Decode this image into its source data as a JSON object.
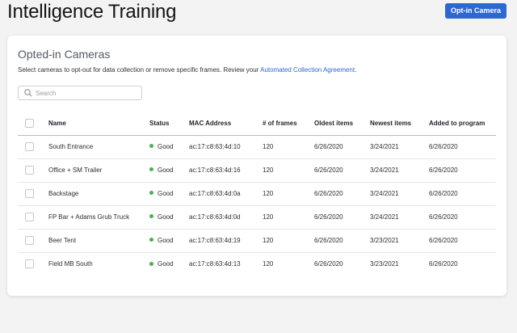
{
  "header": {
    "title": "Intelligence Training",
    "opt_in_label": "Opt-in Camera"
  },
  "card": {
    "title": "Opted-in Cameras",
    "description": "Select cameras to opt-out for data collection or remove specific frames. Review your ",
    "link_text": "Automated Collection Agreement",
    "description_end": "."
  },
  "search": {
    "placeholder": "Search"
  },
  "colors": {
    "accent": "#2d67d4",
    "status_good": "#4caf50"
  },
  "table": {
    "columns": [
      "Name",
      "Status",
      "MAC Address",
      "# of frames",
      "Oldest items",
      "Newest items",
      "Added to program"
    ],
    "rows": [
      {
        "name": "South Entrance",
        "status": "Good",
        "mac": "ac:17:c8:63:4d:10",
        "frames": "120",
        "oldest": "6/26/2020",
        "newest": "3/24/2021",
        "added": "6/26/2020"
      },
      {
        "name": "Office + SM Trailer",
        "status": "Good",
        "mac": "ac:17:c8:63:4d:16",
        "frames": "120",
        "oldest": "6/26/2020",
        "newest": "3/24/2021",
        "added": "6/26/2020"
      },
      {
        "name": "Backstage",
        "status": "Good",
        "mac": "ac:17:c8:63:4d:0a",
        "frames": "120",
        "oldest": "6/26/2020",
        "newest": "3/24/2021",
        "added": "6/26/2020"
      },
      {
        "name": "FP Bar + Adams Grub Truck",
        "status": "Good",
        "mac": "ac:17:c8:63:4d:0d",
        "frames": "120",
        "oldest": "6/26/2020",
        "newest": "3/24/2021",
        "added": "6/26/2020"
      },
      {
        "name": "Beer Tent",
        "status": "Good",
        "mac": "ac:17:c8:63:4d:19",
        "frames": "120",
        "oldest": "6/26/2020",
        "newest": "3/23/2021",
        "added": "6/26/2020"
      },
      {
        "name": "Field MB South",
        "status": "Good",
        "mac": "ac:17:c8:63:4d:13",
        "frames": "120",
        "oldest": "6/26/2020",
        "newest": "3/23/2021",
        "added": "6/26/2020"
      }
    ]
  }
}
